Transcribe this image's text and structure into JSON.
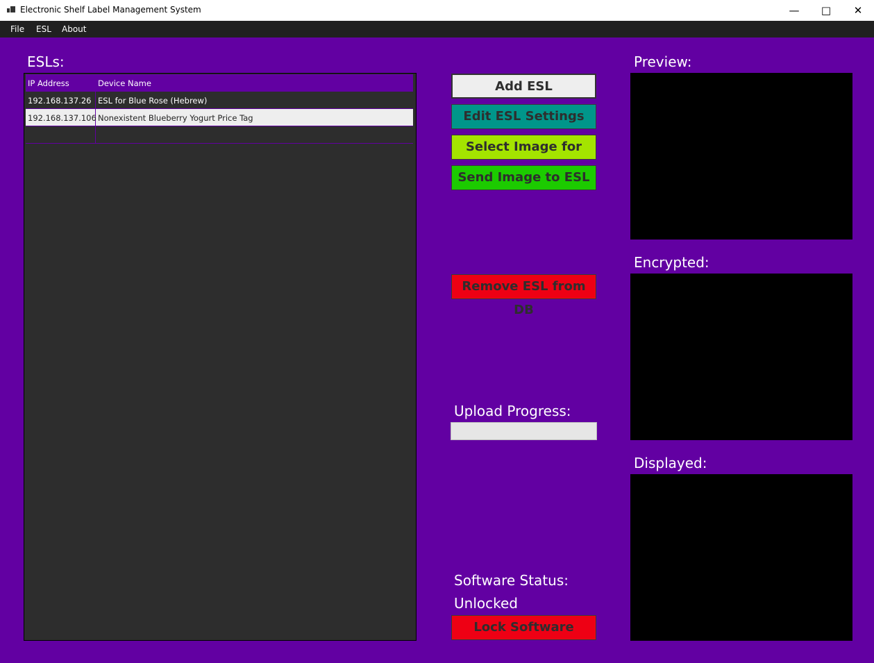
{
  "window": {
    "title": "Electronic Shelf Label Management System",
    "icon": "app-icon",
    "controls": [
      "minimize-icon",
      "maximize-icon",
      "close-icon"
    ]
  },
  "menu": {
    "items": [
      "File",
      "ESL",
      "About"
    ]
  },
  "esls": {
    "label": "ESLs:",
    "columns": [
      "IP Address",
      "Device Name"
    ],
    "rows": [
      {
        "ip": "192.168.137.26",
        "name": "ESL for Blue Rose (Hebrew)",
        "selected": false
      },
      {
        "ip": "192.168.137.106",
        "name": "Nonexistent Blueberry Yogurt Price Tag",
        "selected": true
      }
    ]
  },
  "actions": {
    "add": "Add ESL",
    "edit": "Edit ESL Settings",
    "select_image": "Select Image for ESL",
    "send_image": "Send Image to ESL",
    "remove": "Remove ESL from DB",
    "lock": "Lock Software"
  },
  "colors": {
    "background": "#6200a2",
    "add": "#eeeeee",
    "edit": "#00968a",
    "select_image": "#a4e400",
    "send_image": "#1ccb00",
    "remove": "#ee0014",
    "lock": "#ee0014"
  },
  "upload": {
    "label": "Upload Progress:",
    "progress_percent": 0
  },
  "status": {
    "label": "Software Status:",
    "value": "Unlocked"
  },
  "panels": {
    "preview": "Preview:",
    "encrypted": "Encrypted:",
    "displayed": "Displayed:"
  }
}
